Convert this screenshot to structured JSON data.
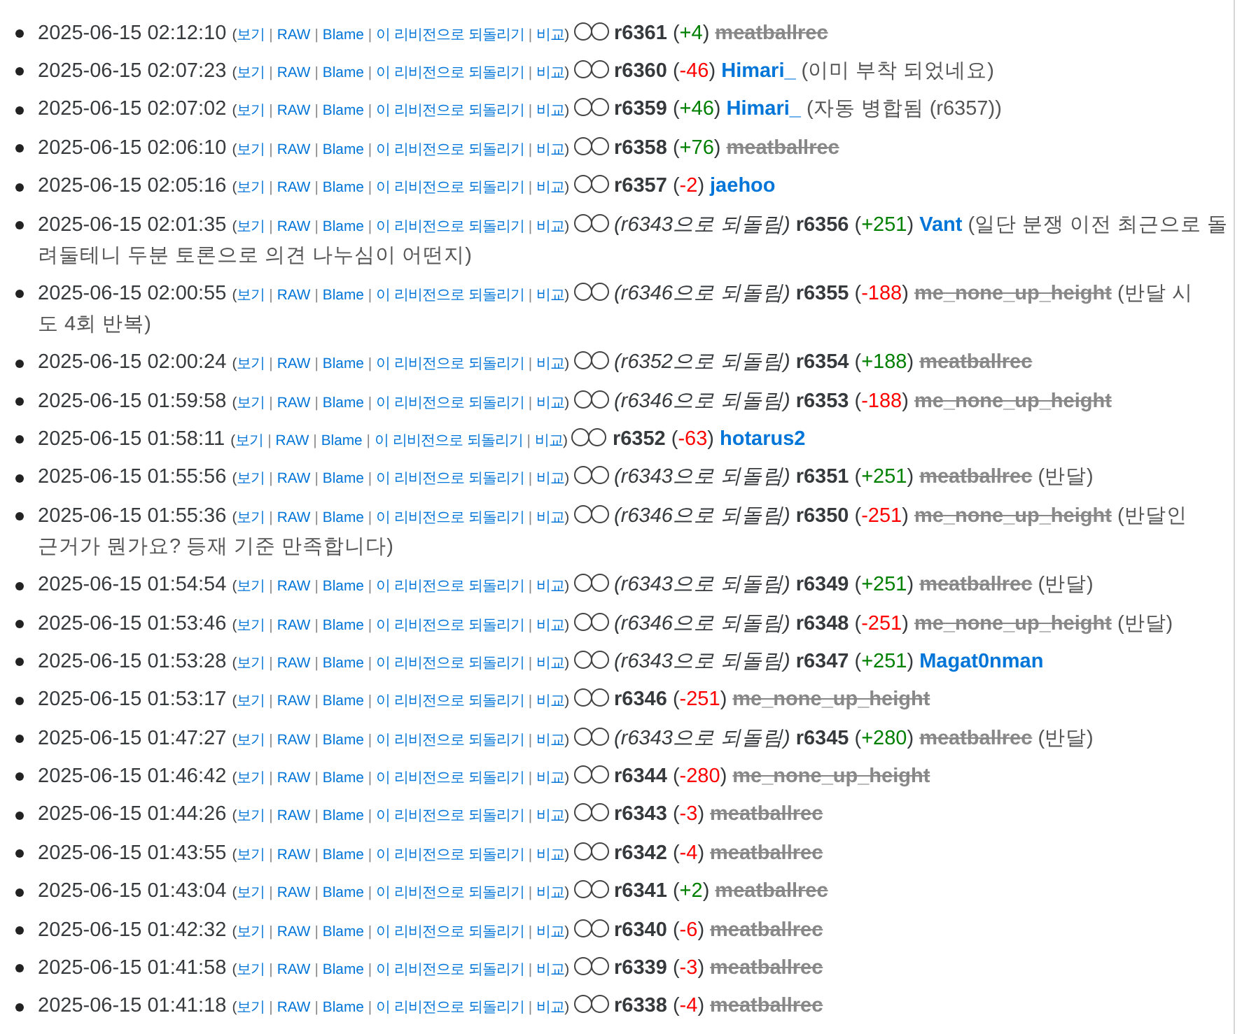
{
  "link_separators": {
    "open": "(",
    "between": "|",
    "close": ")"
  },
  "rows": [
    {
      "time": "2025-06-15 02:12:10",
      "actions": [
        "보기",
        "RAW",
        "Blame",
        "이 리비전으로 되돌리기",
        "비교"
      ],
      "radios": [
        {
          "selected": false
        },
        {
          "selected": false
        }
      ],
      "revision": "r6361",
      "change": {
        "text": "(+4)",
        "kind": "plus"
      },
      "user": {
        "name": "meatballrec",
        "kind": "deleted"
      }
    },
    {
      "time": "2025-06-15 02:07:23",
      "actions": [
        "보기",
        "RAW",
        "Blame",
        "이 리비전으로 되돌리기",
        "비교"
      ],
      "radios": [
        {
          "selected": false
        },
        {
          "selected": false
        }
      ],
      "revision": "r6360",
      "change": {
        "text": "(-46)",
        "kind": "minus"
      },
      "user": {
        "name": "Himari_",
        "kind": "member"
      },
      "comment_lines": [
        "(이미 부착 되었네요)"
      ]
    },
    {
      "time": "2025-06-15 02:07:02",
      "actions": [
        "보기",
        "RAW",
        "Blame",
        "이 리비전으로 되돌리기",
        "비교"
      ],
      "radios": [
        {
          "selected": false
        },
        {
          "selected": false
        }
      ],
      "revision": "r6359",
      "change": {
        "text": "(+46)",
        "kind": "plus"
      },
      "user": {
        "name": "Himari_",
        "kind": "member"
      },
      "comment_lines": [
        "(자동 병합됨 (r6357))"
      ]
    },
    {
      "time": "2025-06-15 02:06:10",
      "actions": [
        "보기",
        "RAW",
        "Blame",
        "이 리비전으로 되돌리기",
        "비교"
      ],
      "radios": [
        {
          "selected": false
        },
        {
          "selected": false
        }
      ],
      "revision": "r6358",
      "change": {
        "text": "(+76)",
        "kind": "plus"
      },
      "user": {
        "name": "meatballrec",
        "kind": "deleted"
      }
    },
    {
      "time": "2025-06-15 02:05:16",
      "actions": [
        "보기",
        "RAW",
        "Blame",
        "이 리비전으로 되돌리기",
        "비교"
      ],
      "radios": [
        {
          "selected": false
        },
        {
          "selected": false
        }
      ],
      "revision": "r6357",
      "change": {
        "text": "(-2)",
        "kind": "minus"
      },
      "user": {
        "name": "jaehoo",
        "kind": "member"
      }
    },
    {
      "time": "2025-06-15 02:01:35",
      "actions": [
        "보기",
        "RAW",
        "Blame",
        "이 리비전으로 되돌리기",
        "비교"
      ],
      "radios": [
        {
          "selected": false
        },
        {
          "selected": false
        }
      ],
      "revert_note": "(r6343으로 되돌림)",
      "revision": "r6356",
      "change": {
        "text": "(+251)",
        "kind": "plus"
      },
      "user": {
        "name": "Vant",
        "kind": "member"
      },
      "comment_lines": [
        "(일단 분쟁 이전 최근으로 돌",
        "려둘테니 두분 토론으로 의견 나누심이 어떤지)"
      ]
    },
    {
      "time": "2025-06-15 02:00:55",
      "actions": [
        "보기",
        "RAW",
        "Blame",
        "이 리비전으로 되돌리기",
        "비교"
      ],
      "radios": [
        {
          "selected": false
        },
        {
          "selected": false
        }
      ],
      "revert_note": "(r6346으로 되돌림)",
      "revision": "r6355",
      "change": {
        "text": "(-188)",
        "kind": "minus"
      },
      "user": {
        "name": "me_none_up_height",
        "kind": "deleted"
      },
      "comment_lines": [
        "(반달 시",
        "도 4회 반복)"
      ]
    },
    {
      "time": "2025-06-15 02:00:24",
      "actions": [
        "보기",
        "RAW",
        "Blame",
        "이 리비전으로 되돌리기",
        "비교"
      ],
      "radios": [
        {
          "selected": false
        },
        {
          "selected": false
        }
      ],
      "revert_note": "(r6352으로 되돌림)",
      "revision": "r6354",
      "change": {
        "text": "(+188)",
        "kind": "plus"
      },
      "user": {
        "name": "meatballrec",
        "kind": "deleted"
      }
    },
    {
      "time": "2025-06-15 01:59:58",
      "actions": [
        "보기",
        "RAW",
        "Blame",
        "이 리비전으로 되돌리기",
        "비교"
      ],
      "radios": [
        {
          "selected": false
        },
        {
          "selected": false
        }
      ],
      "revert_note": "(r6346으로 되돌림)",
      "revision": "r6353",
      "change": {
        "text": "(-188)",
        "kind": "minus"
      },
      "user": {
        "name": "me_none_up_height",
        "kind": "deleted"
      }
    },
    {
      "time": "2025-06-15 01:58:11",
      "actions": [
        "보기",
        "RAW",
        "Blame",
        "이 리비전으로 되돌리기",
        "비교"
      ],
      "radios": [
        {
          "selected": false
        },
        {
          "selected": false
        }
      ],
      "revision": "r6352",
      "change": {
        "text": "(-63)",
        "kind": "minus"
      },
      "user": {
        "name": "hotarus2",
        "kind": "member"
      }
    },
    {
      "time": "2025-06-15 01:55:56",
      "actions": [
        "보기",
        "RAW",
        "Blame",
        "이 리비전으로 되돌리기",
        "비교"
      ],
      "radios": [
        {
          "selected": false
        },
        {
          "selected": false
        }
      ],
      "revert_note": "(r6343으로 되돌림)",
      "revision": "r6351",
      "change": {
        "text": "(+251)",
        "kind": "plus"
      },
      "user": {
        "name": "meatballrec",
        "kind": "deleted"
      },
      "comment_lines": [
        "(반달)"
      ]
    },
    {
      "time": "2025-06-15 01:55:36",
      "actions": [
        "보기",
        "RAW",
        "Blame",
        "이 리비전으로 되돌리기",
        "비교"
      ],
      "radios": [
        {
          "selected": false
        },
        {
          "selected": false
        }
      ],
      "revert_note": "(r6346으로 되돌림)",
      "revision": "r6350",
      "change": {
        "text": "(-251)",
        "kind": "minus"
      },
      "user": {
        "name": "me_none_up_height",
        "kind": "deleted"
      },
      "comment_lines": [
        "(반달인",
        "근거가 뭔가요? 등재 기준 만족합니다)"
      ]
    },
    {
      "time": "2025-06-15 01:54:54",
      "actions": [
        "보기",
        "RAW",
        "Blame",
        "이 리비전으로 되돌리기",
        "비교"
      ],
      "radios": [
        {
          "selected": false
        },
        {
          "selected": false
        }
      ],
      "revert_note": "(r6343으로 되돌림)",
      "revision": "r6349",
      "change": {
        "text": "(+251)",
        "kind": "plus"
      },
      "user": {
        "name": "meatballrec",
        "kind": "deleted"
      },
      "comment_lines": [
        "(반달)"
      ]
    },
    {
      "time": "2025-06-15 01:53:46",
      "actions": [
        "보기",
        "RAW",
        "Blame",
        "이 리비전으로 되돌리기",
        "비교"
      ],
      "radios": [
        {
          "selected": false
        },
        {
          "selected": false
        }
      ],
      "revert_note": "(r6346으로 되돌림)",
      "revision": "r6348",
      "change": {
        "text": "(-251)",
        "kind": "minus"
      },
      "user": {
        "name": "me_none_up_height",
        "kind": "deleted"
      },
      "comment_lines": [
        "(반달)"
      ]
    },
    {
      "time": "2025-06-15 01:53:28",
      "actions": [
        "보기",
        "RAW",
        "Blame",
        "이 리비전으로 되돌리기",
        "비교"
      ],
      "radios": [
        {
          "selected": false
        },
        {
          "selected": false
        }
      ],
      "revert_note": "(r6343으로 되돌림)",
      "revision": "r6347",
      "change": {
        "text": "(+251)",
        "kind": "plus"
      },
      "user": {
        "name": "Magat0nman",
        "kind": "member"
      }
    },
    {
      "time": "2025-06-15 01:53:17",
      "actions": [
        "보기",
        "RAW",
        "Blame",
        "이 리비전으로 되돌리기",
        "비교"
      ],
      "radios": [
        {
          "selected": false
        },
        {
          "selected": false
        }
      ],
      "revision": "r6346",
      "change": {
        "text": "(-251)",
        "kind": "minus"
      },
      "user": {
        "name": "me_none_up_height",
        "kind": "deleted"
      }
    },
    {
      "time": "2025-06-15 01:47:27",
      "actions": [
        "보기",
        "RAW",
        "Blame",
        "이 리비전으로 되돌리기",
        "비교"
      ],
      "radios": [
        {
          "selected": false
        },
        {
          "selected": false
        }
      ],
      "revert_note": "(r6343으로 되돌림)",
      "revision": "r6345",
      "change": {
        "text": "(+280)",
        "kind": "plus"
      },
      "user": {
        "name": "meatballrec",
        "kind": "deleted"
      },
      "comment_lines": [
        "(반달)"
      ]
    },
    {
      "time": "2025-06-15 01:46:42",
      "actions": [
        "보기",
        "RAW",
        "Blame",
        "이 리비전으로 되돌리기",
        "비교"
      ],
      "radios": [
        {
          "selected": false
        },
        {
          "selected": false
        }
      ],
      "revision": "r6344",
      "change": {
        "text": "(-280)",
        "kind": "minus"
      },
      "user": {
        "name": "me_none_up_height",
        "kind": "deleted"
      }
    },
    {
      "time": "2025-06-15 01:44:26",
      "actions": [
        "보기",
        "RAW",
        "Blame",
        "이 리비전으로 되돌리기",
        "비교"
      ],
      "radios": [
        {
          "selected": false
        },
        {
          "selected": false
        }
      ],
      "revision": "r6343",
      "change": {
        "text": "(-3)",
        "kind": "minus"
      },
      "user": {
        "name": "meatballrec",
        "kind": "deleted"
      }
    },
    {
      "time": "2025-06-15 01:43:55",
      "actions": [
        "보기",
        "RAW",
        "Blame",
        "이 리비전으로 되돌리기",
        "비교"
      ],
      "radios": [
        {
          "selected": false
        },
        {
          "selected": false
        }
      ],
      "revision": "r6342",
      "change": {
        "text": "(-4)",
        "kind": "minus"
      },
      "user": {
        "name": "meatballrec",
        "kind": "deleted"
      }
    },
    {
      "time": "2025-06-15 01:43:04",
      "actions": [
        "보기",
        "RAW",
        "Blame",
        "이 리비전으로 되돌리기",
        "비교"
      ],
      "radios": [
        {
          "selected": false
        },
        {
          "selected": false
        }
      ],
      "revision": "r6341",
      "change": {
        "text": "(+2)",
        "kind": "plus"
      },
      "user": {
        "name": "meatballrec",
        "kind": "deleted"
      }
    },
    {
      "time": "2025-06-15 01:42:32",
      "actions": [
        "보기",
        "RAW",
        "Blame",
        "이 리비전으로 되돌리기",
        "비교"
      ],
      "radios": [
        {
          "selected": false
        },
        {
          "selected": false
        }
      ],
      "revision": "r6340",
      "change": {
        "text": "(-6)",
        "kind": "minus"
      },
      "user": {
        "name": "meatballrec",
        "kind": "deleted"
      }
    },
    {
      "time": "2025-06-15 01:41:58",
      "actions": [
        "보기",
        "RAW",
        "Blame",
        "이 리비전으로 되돌리기",
        "비교"
      ],
      "radios": [
        {
          "selected": false
        },
        {
          "selected": false
        }
      ],
      "revision": "r6339",
      "change": {
        "text": "(-3)",
        "kind": "minus"
      },
      "user": {
        "name": "meatballrec",
        "kind": "deleted"
      }
    },
    {
      "time": "2025-06-15 01:41:18",
      "actions": [
        "보기",
        "RAW",
        "Blame",
        "이 리비전으로 되돌리기",
        "비교"
      ],
      "radios": [
        {
          "selected": false
        },
        {
          "selected": false
        }
      ],
      "revision": "r6338",
      "change": {
        "text": "(-4)",
        "kind": "minus"
      },
      "user": {
        "name": "meatballrec",
        "kind": "deleted"
      }
    }
  ]
}
